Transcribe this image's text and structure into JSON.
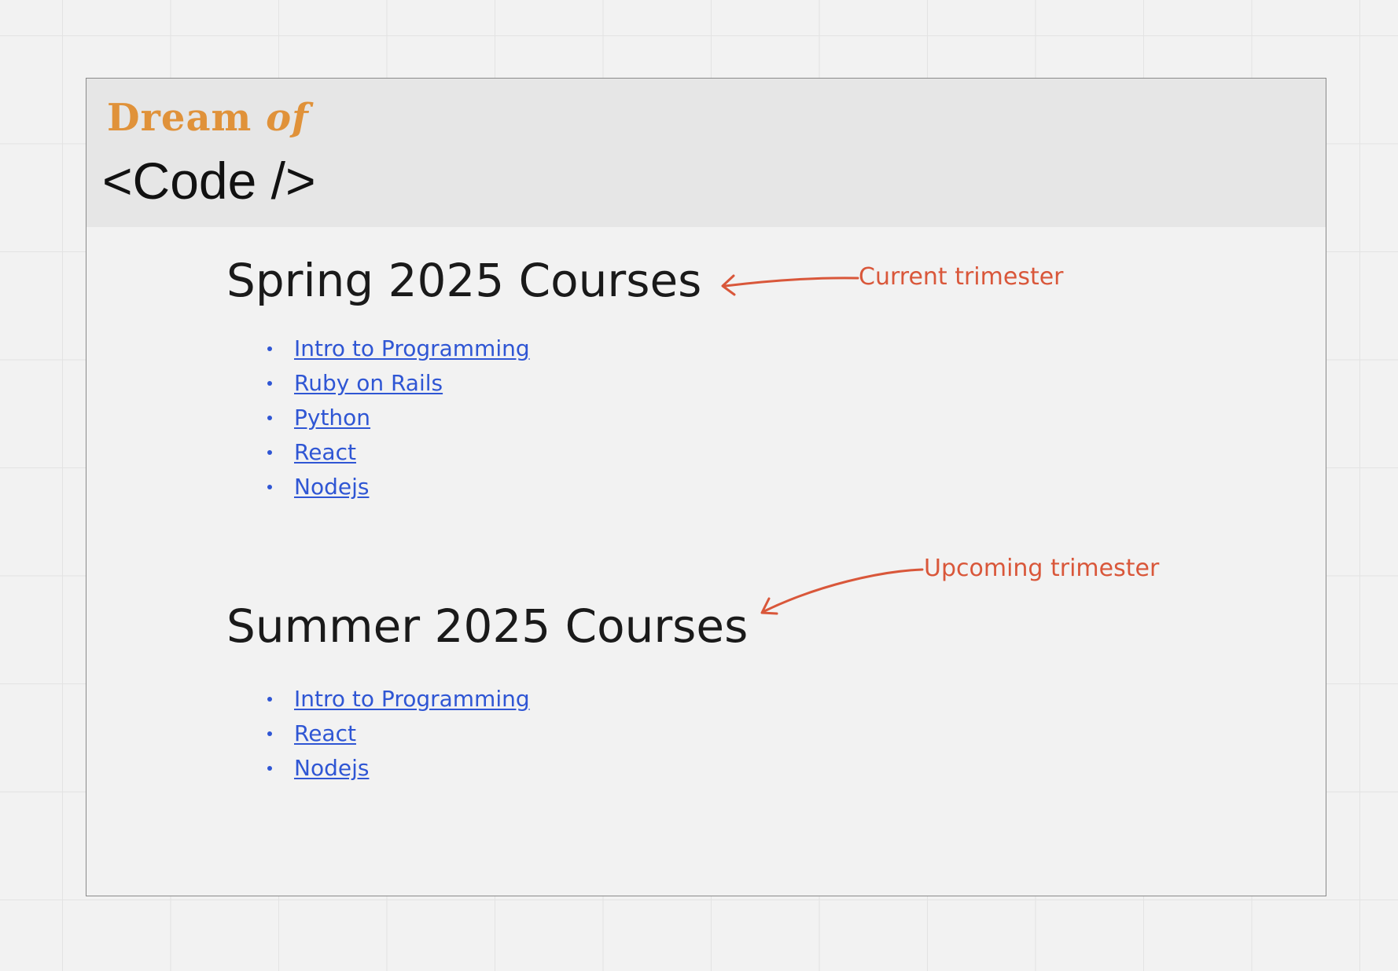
{
  "header": {
    "logo_dream": "Dream",
    "logo_of": "of",
    "logo_code": "<Code />"
  },
  "sections": [
    {
      "title": "Spring 2025 Courses",
      "courses": [
        "Intro to Programming",
        "Ruby on Rails",
        "Python",
        "React",
        "Nodejs"
      ]
    },
    {
      "title": "Summer 2025 Courses",
      "courses": [
        "Intro to Programming",
        "React",
        "Nodejs"
      ]
    }
  ],
  "annotations": {
    "current": "Current trimester",
    "upcoming": "Upcoming trimester",
    "color": "#d9573a"
  },
  "colors": {
    "link": "#2f56d4",
    "logo_accent": "#e0923a",
    "header_bg": "#e6e6e6"
  }
}
